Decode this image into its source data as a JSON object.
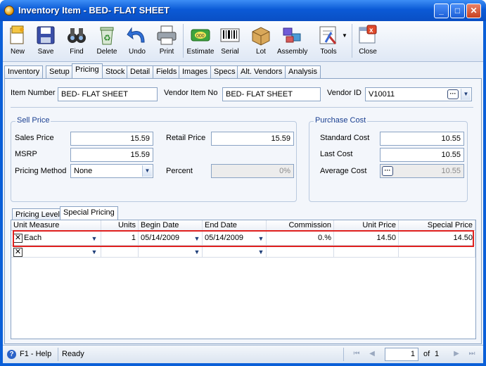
{
  "window": {
    "title": "Inventory Item - BED- FLAT SHEET"
  },
  "toolbar": {
    "buttons": [
      {
        "label": "New",
        "icon": "new-document-icon"
      },
      {
        "label": "Save",
        "icon": "floppy-disk-icon"
      },
      {
        "label": "Find",
        "icon": "binoculars-icon"
      },
      {
        "label": "Delete",
        "icon": "recycle-bin-icon"
      },
      {
        "label": "Undo",
        "icon": "undo-arrow-icon"
      },
      {
        "label": "Print",
        "icon": "printer-icon"
      },
      {
        "label": "Estimate",
        "icon": "estimate-icon"
      },
      {
        "label": "Serial",
        "icon": "barcode-icon"
      },
      {
        "label": "Lot",
        "icon": "box-icon"
      },
      {
        "label": "Assembly",
        "icon": "assembly-icon"
      },
      {
        "label": "Tools",
        "icon": "tools-icon"
      },
      {
        "label": "Close",
        "icon": "close-window-icon"
      }
    ]
  },
  "tabs": [
    "Inventory",
    "Setup",
    "Pricing",
    "Stock",
    "Detail",
    "Fields",
    "Images",
    "Specs",
    "Alt. Vendors",
    "Analysis"
  ],
  "active_tab": "Pricing",
  "header": {
    "item_number_label": "Item Number",
    "item_number": "BED- FLAT SHEET",
    "vendor_item_no_label": "Vendor Item No",
    "vendor_item_no": "BED- FLAT SHEET",
    "vendor_id_label": "Vendor ID",
    "vendor_id": "V10011"
  },
  "sell_price": {
    "title": "Sell Price",
    "sales_price_label": "Sales Price",
    "sales_price": "15.59",
    "retail_price_label": "Retail Price",
    "retail_price": "15.59",
    "msrp_label": "MSRP",
    "msrp": "15.59",
    "pricing_method_label": "Pricing Method",
    "pricing_method": "None",
    "percent_label": "Percent",
    "percent": "0%"
  },
  "purchase_cost": {
    "title": "Purchase Cost",
    "standard_cost_label": "Standard Cost",
    "standard_cost": "10.55",
    "last_cost_label": "Last Cost",
    "last_cost": "10.55",
    "average_cost_label": "Average Cost",
    "average_cost": "10.55"
  },
  "inner_tabs": [
    "Pricing Level",
    "Special Pricing"
  ],
  "grid": {
    "columns": [
      "Unit Measure",
      "Units",
      "Begin Date",
      "End Date",
      "Commission",
      "Unit Price",
      "Special Price"
    ],
    "rows": [
      {
        "unit_measure": "Each",
        "units": "1",
        "begin_date": "05/14/2009",
        "end_date": "05/14/2009",
        "commission": "0.%",
        "unit_price": "14.50",
        "special_price": "14.50"
      }
    ]
  },
  "status": {
    "help": "F1 - Help",
    "state": "Ready",
    "page": "1",
    "of_label": "of",
    "total": "1"
  }
}
